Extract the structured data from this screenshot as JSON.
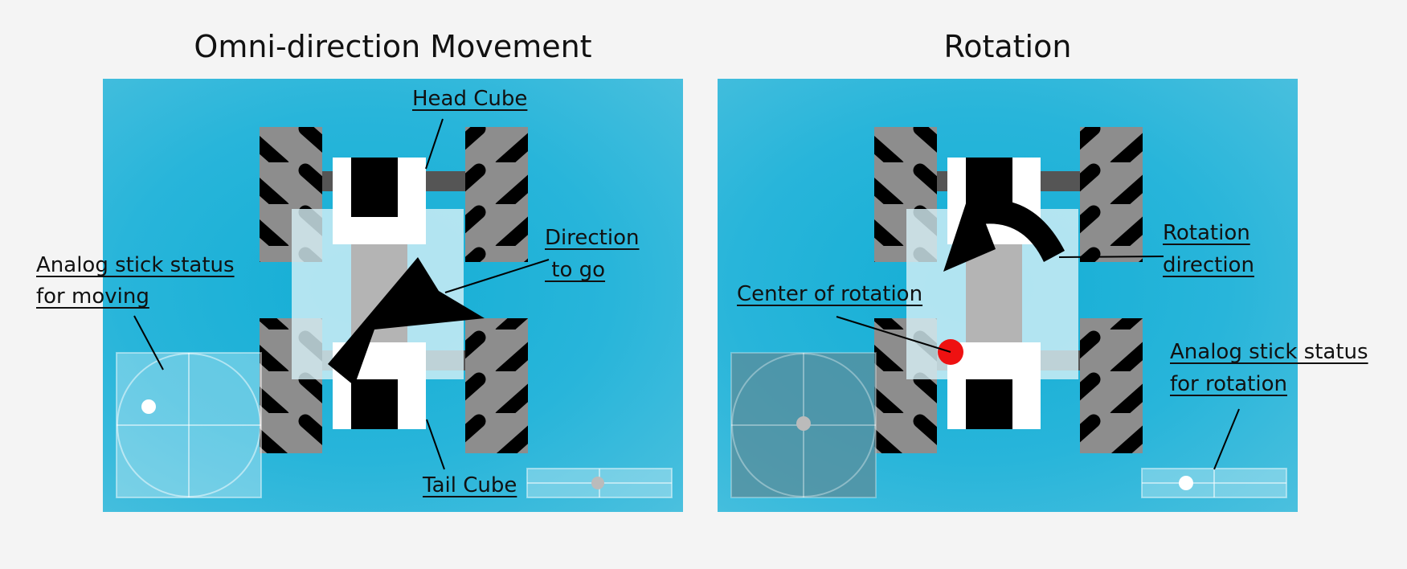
{
  "left_panel": {
    "title": "Omni-direction Movement",
    "labels": {
      "head_cube": "Head Cube",
      "tail_cube": "Tail Cube",
      "direction_line1": "Direction",
      "direction_line2": " to go",
      "stick_line1": "Analog stick status",
      "stick_line2": "for moving"
    }
  },
  "right_panel": {
    "title": "Rotation",
    "labels": {
      "rotation_dir_line1": "Rotation",
      "rotation_dir_line2": "direction",
      "center": "Center of rotation",
      "stick_line1": "Analog stick status",
      "stick_line2": "for rotation"
    }
  },
  "colors": {
    "background": "#f4f4f4",
    "panel": "#22b2d8",
    "center_marker": "#ee1111"
  },
  "icons": [
    "move-arrow-icon",
    "rotation-arrow-icon",
    "center-of-rotation-dot"
  ]
}
